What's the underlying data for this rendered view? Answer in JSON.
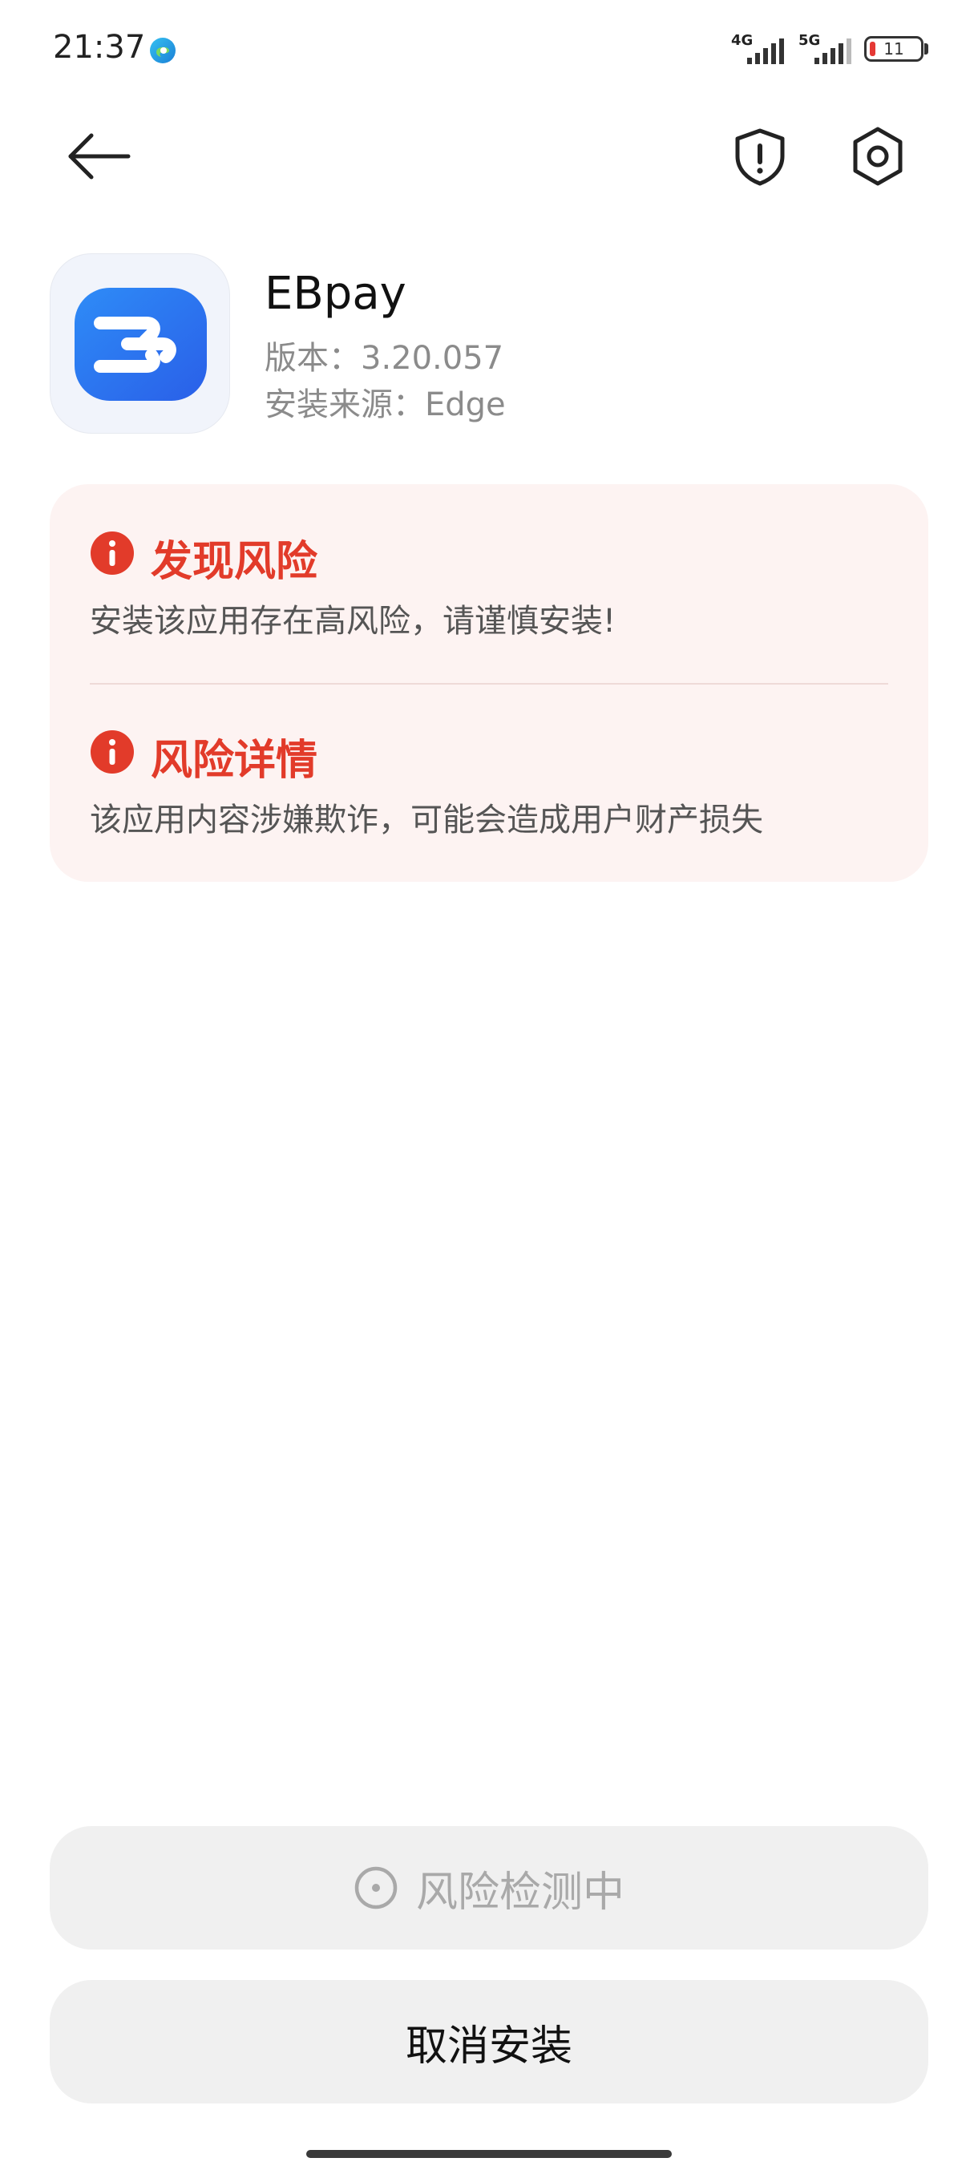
{
  "status_bar": {
    "time": "21:37",
    "network_1": "4G",
    "network_2": "5G",
    "battery_level": "11",
    "notification_icon": "edge-browser-icon"
  },
  "nav": {
    "back_icon": "back-arrow-icon",
    "shield_icon": "shield-alert-icon",
    "settings_icon": "gear-icon"
  },
  "app": {
    "name": "EBpay",
    "version": "版本：3.20.057",
    "source": "安装来源：Edge"
  },
  "risk": {
    "found": {
      "title": "发现风险",
      "description": "安装该应用存在高风险，请谨慎安装!"
    },
    "details": {
      "title": "风险详情",
      "description": "该应用内容涉嫌欺诈，可能会造成用户财产损失"
    }
  },
  "buttons": {
    "scan_label": "风险检测中",
    "cancel_label": "取消安装"
  },
  "colors": {
    "risk_red": "#e23b2a",
    "card_bg": "#fdf3f2",
    "button_bg": "#f0f0f0",
    "app_blue": "#2f6ef2"
  }
}
